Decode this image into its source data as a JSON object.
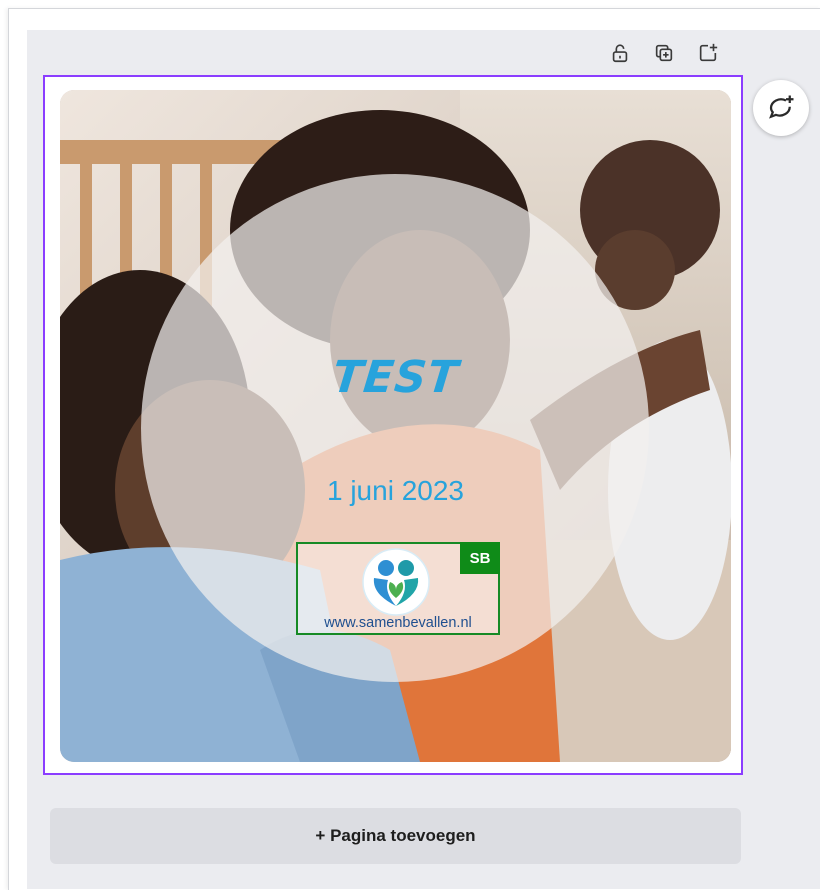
{
  "toolbar": {
    "lock_icon": "lock-open-icon",
    "duplicate_icon": "duplicate-page-icon",
    "add_icon": "add-page-icon"
  },
  "design": {
    "title": "TEST",
    "date": "1 juni 2023",
    "logo": {
      "badge": "SB",
      "url": "www.samenbevallen.nl"
    },
    "accent_color": "#27a3dc",
    "selection_color": "#8b3dff"
  },
  "comment": {
    "icon": "add-comment-icon"
  },
  "footer": {
    "add_page_label": "+ Pagina toevoegen"
  }
}
